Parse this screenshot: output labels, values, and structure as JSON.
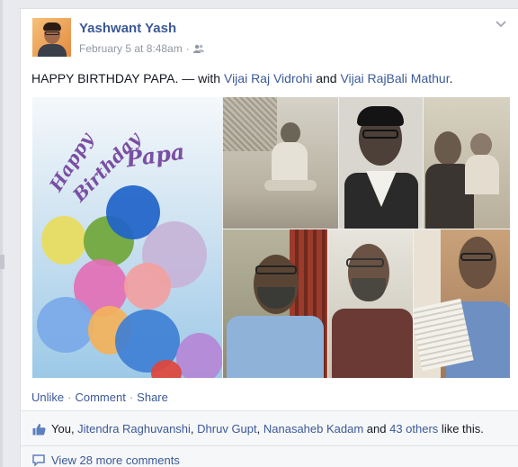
{
  "post": {
    "author": "Yashwant Yash",
    "timestamp": "February 5 at 8:48am",
    "separator": "·",
    "status_text": "HAPPY BIRTHDAY PAPA.",
    "with_text": " — with ",
    "tagged_1": "Vijai Raj Vidrohi",
    "and_text": " and ",
    "tagged_2": "Vijai RajBali Mathur",
    "period": "."
  },
  "collage": {
    "happy_text": "Happy",
    "birthday_text": "Birthday",
    "papa_text": "Papa"
  },
  "actions": {
    "unlike": "Unlike",
    "comment": "Comment",
    "share": "Share",
    "sep": "·"
  },
  "likes": {
    "you": "You, ",
    "person_1": "Jitendra Raghuvanshi",
    "comma_1": ", ",
    "person_2": "Dhruv Gupt",
    "comma_2": ", ",
    "person_3": "Nanasaheb Kadam",
    "and_text": " and ",
    "others": "43 others",
    "suffix": " like this."
  },
  "comments": {
    "view_more": "View 28 more comments"
  },
  "colors": {
    "link": "#3b5998",
    "meta": "#9197a3",
    "text": "#141823"
  },
  "icons": {
    "audience": "friends-icon",
    "options": "chevron-down-icon",
    "like": "thumbs-up-icon",
    "comment": "comment-bubble-icon"
  }
}
